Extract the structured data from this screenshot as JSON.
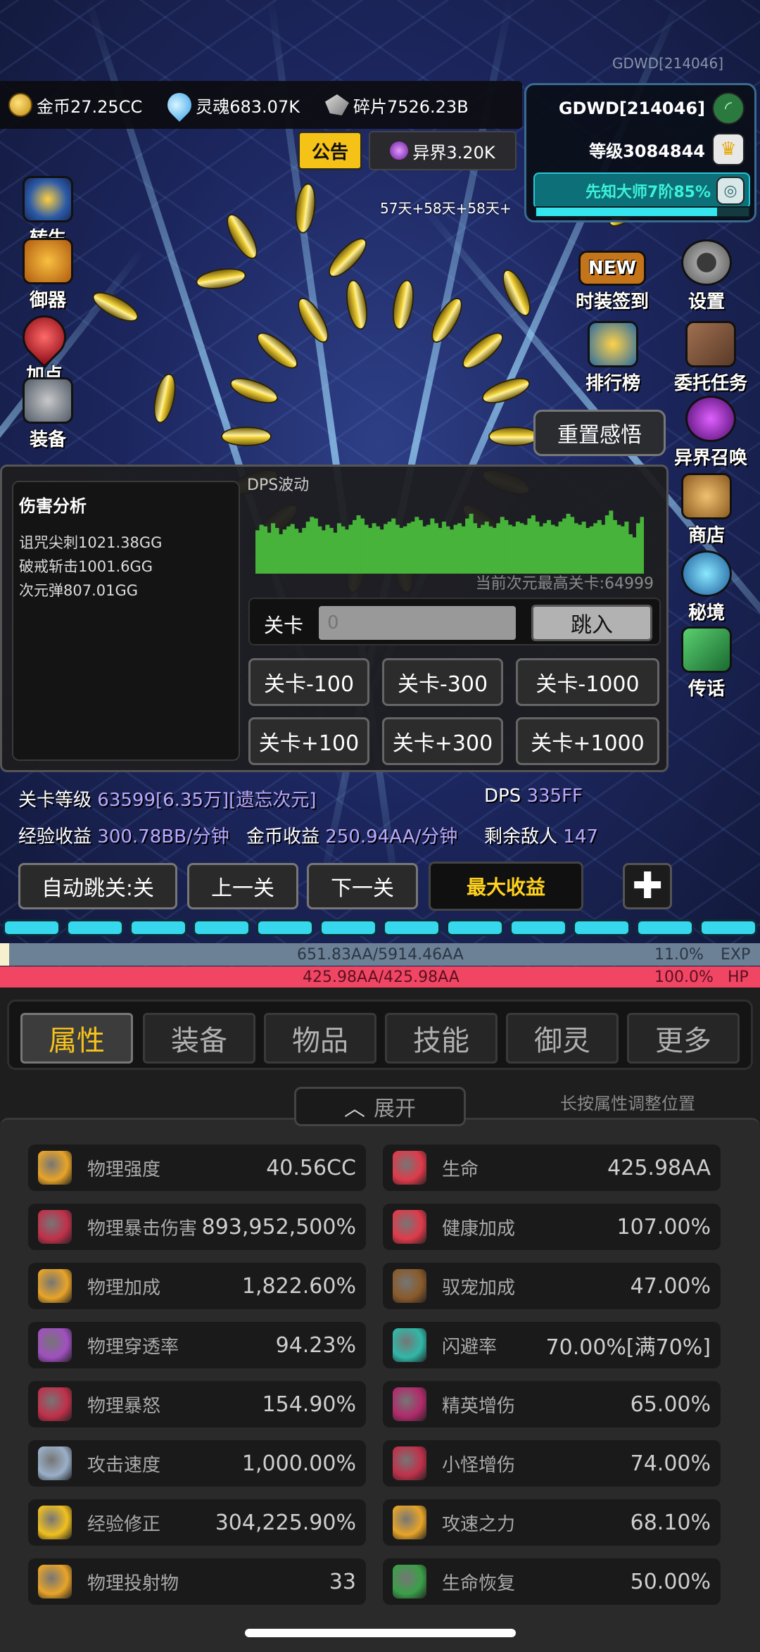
{
  "watermark": "GDWD[214046]",
  "currency": {
    "gold": "金币27.25CC",
    "soul": "灵魂683.07K",
    "shard": "碎片7526.23B"
  },
  "player": {
    "name": "GDWD[214046]",
    "level": "等级3084844",
    "title": "先知大师7阶85%",
    "title_progress": 0.85
  },
  "notice": {
    "label": "公告",
    "otherworld": "异界3.20K"
  },
  "buffs": "57天+58天+58天+",
  "left_menu": [
    {
      "label": "转生",
      "name": "rebirth"
    },
    {
      "label": "御器",
      "name": "artifact"
    },
    {
      "label": "加点",
      "name": "add-points"
    },
    {
      "label": "装备",
      "name": "equipment"
    }
  ],
  "right_menu": [
    {
      "label": "时装签到",
      "name": "fashion-checkin"
    },
    {
      "label": "设置",
      "name": "settings"
    },
    {
      "label": "排行榜",
      "name": "leaderboard"
    },
    {
      "label": "委托任务",
      "name": "commission-tasks"
    },
    {
      "label": "异界召唤",
      "name": "otherworld-summon"
    },
    {
      "label": "商店",
      "name": "shop"
    },
    {
      "label": "秘境",
      "name": "secret-realm"
    },
    {
      "label": "传话",
      "name": "message"
    }
  ],
  "reset_button": "重置感悟",
  "damage": {
    "title": "伤害分析",
    "lines": [
      "诅咒尖刺1021.38GG",
      "破戒斩击1001.6GG",
      "次元弹807.01GG"
    ]
  },
  "dps": {
    "label": "DPS波动",
    "bars": [
      55,
      62,
      60,
      52,
      64,
      58,
      50,
      56,
      60,
      63,
      57,
      52,
      58,
      66,
      72,
      70,
      60,
      55,
      62,
      58,
      52,
      64,
      60,
      56,
      62,
      68,
      74,
      70,
      62,
      58,
      64,
      60,
      56,
      63,
      66,
      70,
      62,
      58,
      60,
      64,
      66,
      72,
      68,
      60,
      62,
      70,
      64,
      58,
      66,
      60,
      56,
      62,
      64,
      60,
      70,
      76,
      64,
      58,
      62,
      66,
      60,
      58,
      64,
      72,
      68,
      62,
      60,
      66,
      64,
      62,
      70,
      74,
      66,
      60,
      64,
      68,
      62,
      60,
      66,
      70,
      76,
      72,
      64,
      62,
      66,
      58,
      60,
      64,
      68,
      62,
      74,
      80,
      68,
      62,
      60,
      66,
      50,
      46,
      64,
      72
    ]
  },
  "max_level": "当前次元最高关卡:64999",
  "level_jump": {
    "label": "关卡",
    "placeholder": "0",
    "jump": "跳入"
  },
  "level_buttons": [
    "关卡-100",
    "关卡-300",
    "关卡-1000",
    "关卡+100",
    "关卡+300",
    "关卡+1000"
  ],
  "stage": {
    "level_label": "关卡等级",
    "level_value": "63599[6.35万][遗忘次元]",
    "dps_label": "DPS",
    "dps_value": "335FF",
    "exp_label": "经验收益",
    "exp_value": "300.78BB/分钟",
    "gold_label": "金币收益",
    "gold_value": "250.94AA/分钟",
    "enemy_label": "剩余敌人",
    "enemy_value": "147"
  },
  "controls": {
    "auto_skip": "自动跳关:关",
    "prev": "上一关",
    "next": "下一关",
    "max": "最大收益"
  },
  "exp_bar": {
    "text": "651.83AA/5914.46AA",
    "pct": "11.0%",
    "label": "EXP",
    "fill": 0.11
  },
  "hp_bar": {
    "text": "425.98AA/425.98AA",
    "pct": "100.0%",
    "label": "HP",
    "fill": 1.0
  },
  "tabs": [
    "属性",
    "装备",
    "物品",
    "技能",
    "御灵",
    "更多"
  ],
  "expand": "展开",
  "hint": "长按属性调整位置",
  "stats": [
    {
      "name": "物理强度",
      "value": "40.56CC",
      "icon": "golden-arrow-icon",
      "color": "#e8a428"
    },
    {
      "name": "生命",
      "value": "425.98AA",
      "icon": "heart-icon",
      "color": "#e03a4a"
    },
    {
      "name": "物理暴击伤害",
      "value": "893,952,500%",
      "icon": "crit-sword-icon",
      "color": "#c0304a"
    },
    {
      "name": "健康加成",
      "value": "107.00%",
      "icon": "heart-plus-icon",
      "color": "#e03a4a"
    },
    {
      "name": "物理加成",
      "value": "1,822.60%",
      "icon": "sword-up-icon",
      "color": "#e8a428"
    },
    {
      "name": "驭宠加成",
      "value": "47.00%",
      "icon": "paw-icon",
      "color": "#8a5a2a"
    },
    {
      "name": "物理穿透率",
      "value": "94.23%",
      "icon": "pierce-icon",
      "color": "#a050c0"
    },
    {
      "name": "闪避率",
      "value": "70.00%[满70%]",
      "icon": "dodge-icon",
      "color": "#30b8a8"
    },
    {
      "name": "物理暴怒",
      "value": "154.90%",
      "icon": "rage-icon",
      "color": "#c0304a"
    },
    {
      "name": "精英增伤",
      "value": "65.00%",
      "icon": "elite-demon-icon",
      "color": "#b02a6a"
    },
    {
      "name": "攻击速度",
      "value": "1,000.00%",
      "icon": "attack-speed-icon",
      "color": "#9ab0c8"
    },
    {
      "name": "小怪增伤",
      "value": "74.00%",
      "icon": "minion-demon-icon",
      "color": "#c0304a"
    },
    {
      "name": "经验修正",
      "value": "304,225.90%",
      "icon": "crown-icon",
      "color": "#f0c020"
    },
    {
      "name": "攻速之力",
      "value": "68.10%",
      "icon": "speed-power-icon",
      "color": "#e8a428"
    },
    {
      "name": "物理投射物",
      "value": "33",
      "icon": "projectile-icon",
      "color": "#e8a428"
    },
    {
      "name": "生命恢复",
      "value": "50.00%",
      "icon": "leaf-icon",
      "color": "#3aa048"
    }
  ]
}
